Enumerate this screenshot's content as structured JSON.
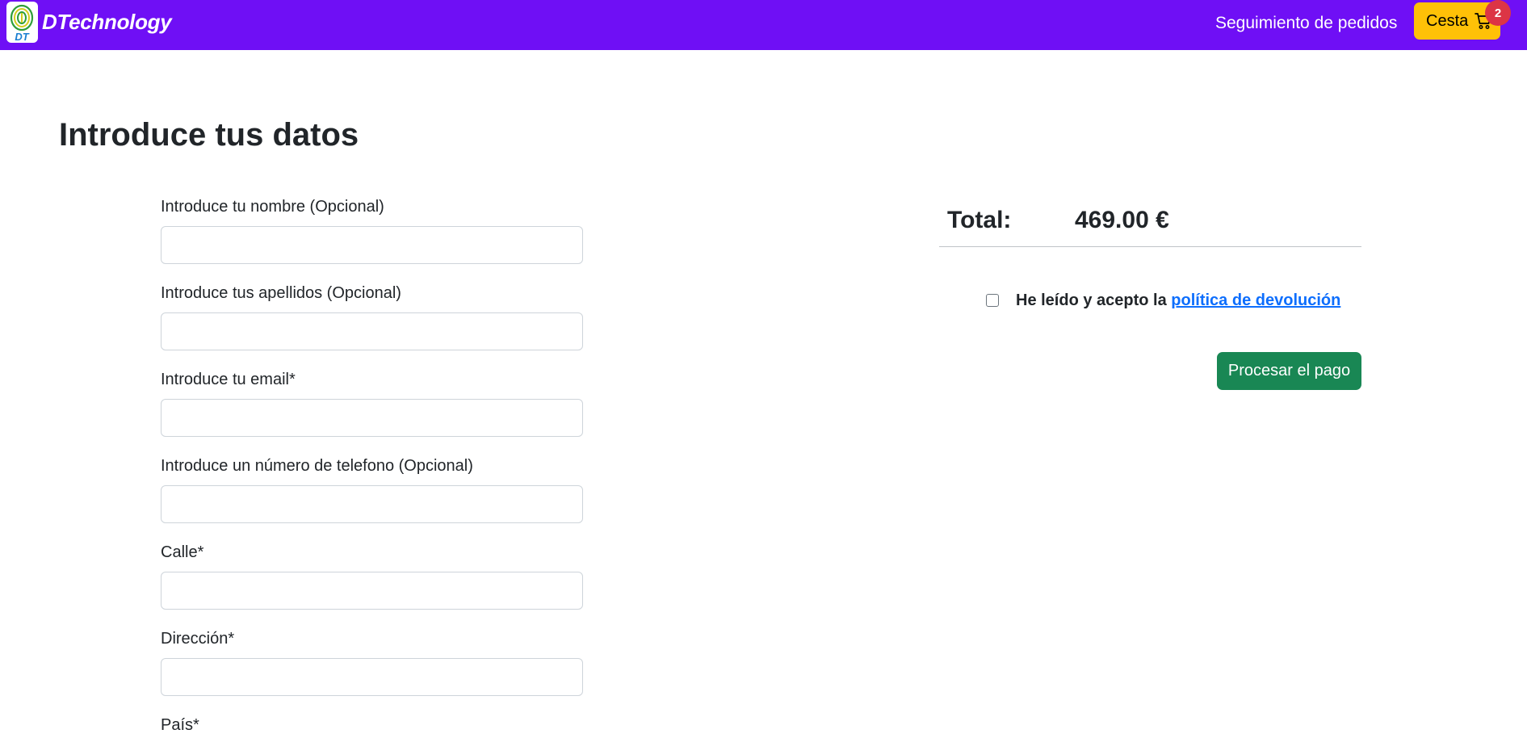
{
  "navbar": {
    "brand_logo_text": "DT",
    "brand_name": "DTechnology",
    "orders_link": "Seguimiento de pedidos",
    "cart_label": "Cesta",
    "cart_count": "2",
    "cart_icon": "cart-icon",
    "bg_color": "#6f0ff5",
    "cart_color": "#ffc107"
  },
  "page": {
    "title": "Introduce tus datos"
  },
  "form": {
    "fields": [
      {
        "label": "Introduce tu nombre (Opcional)",
        "value": ""
      },
      {
        "label": "Introduce tus apellidos (Opcional)",
        "value": ""
      },
      {
        "label": "Introduce tu email*",
        "value": ""
      },
      {
        "label": "Introduce un número de telefono (Opcional)",
        "value": ""
      },
      {
        "label": "Calle*",
        "value": ""
      },
      {
        "label": "Dirección*",
        "value": ""
      },
      {
        "label": "País*",
        "value": ""
      }
    ]
  },
  "summary": {
    "total_label": "Total:",
    "total_value": "469.00 €",
    "policy_prefix": "He leído y acepto la",
    "policy_link": "política de devolución",
    "policy_checked": false,
    "pay_button": "Procesar el pago",
    "pay_color": "#198754"
  }
}
